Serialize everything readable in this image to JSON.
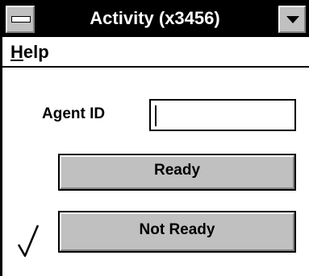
{
  "window": {
    "title": "Activity (x3456)"
  },
  "menu": {
    "help_mnemonic": "H",
    "help_rest": "elp"
  },
  "form": {
    "agent_id_label": "Agent ID",
    "agent_id_value": "",
    "ready_label": "Ready",
    "not_ready_label": "Not Ready",
    "selected_status": "Not Ready"
  },
  "icons": {
    "system_menu": "system-menu-icon",
    "dropdown": "chevron-down-icon",
    "status_check": "checkmark-icon"
  }
}
